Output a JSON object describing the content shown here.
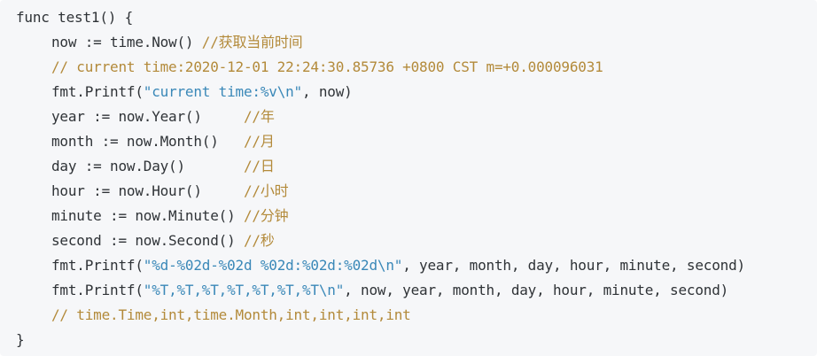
{
  "code": {
    "lines": [
      {
        "indent": 0,
        "tokens": [
          {
            "t": "plain",
            "text": "func test1() {"
          }
        ]
      },
      {
        "indent": 1,
        "tokens": [
          {
            "t": "plain",
            "text": "now := time.Now() "
          },
          {
            "t": "comment",
            "text": "//获取当前时间"
          }
        ]
      },
      {
        "indent": 1,
        "tokens": [
          {
            "t": "comment",
            "text": "// current time:2020-12-01 22:24:30.85736 +0800 CST m=+0.000096031"
          }
        ]
      },
      {
        "indent": 1,
        "tokens": [
          {
            "t": "plain",
            "text": "fmt.Printf("
          },
          {
            "t": "string",
            "text": "\"current time:%v\\n\""
          },
          {
            "t": "plain",
            "text": ", now)"
          }
        ]
      },
      {
        "indent": 1,
        "tokens": [
          {
            "t": "plain",
            "text": "year := now.Year()     "
          },
          {
            "t": "comment",
            "text": "//年"
          }
        ]
      },
      {
        "indent": 1,
        "tokens": [
          {
            "t": "plain",
            "text": "month := now.Month()   "
          },
          {
            "t": "comment",
            "text": "//月"
          }
        ]
      },
      {
        "indent": 1,
        "tokens": [
          {
            "t": "plain",
            "text": "day := now.Day()       "
          },
          {
            "t": "comment",
            "text": "//日"
          }
        ]
      },
      {
        "indent": 1,
        "tokens": [
          {
            "t": "plain",
            "text": "hour := now.Hour()     "
          },
          {
            "t": "comment",
            "text": "//小时"
          }
        ]
      },
      {
        "indent": 1,
        "tokens": [
          {
            "t": "plain",
            "text": "minute := now.Minute() "
          },
          {
            "t": "comment",
            "text": "//分钟"
          }
        ]
      },
      {
        "indent": 1,
        "tokens": [
          {
            "t": "plain",
            "text": "second := now.Second() "
          },
          {
            "t": "comment",
            "text": "//秒"
          }
        ]
      },
      {
        "indent": 1,
        "tokens": [
          {
            "t": "plain",
            "text": "fmt.Printf("
          },
          {
            "t": "string",
            "text": "\"%d-%02d-%02d %02d:%02d:%02d\\n\""
          },
          {
            "t": "plain",
            "text": ", year, month, day, hour, minute, second)"
          }
        ]
      },
      {
        "indent": 1,
        "tokens": [
          {
            "t": "plain",
            "text": "fmt.Printf("
          },
          {
            "t": "string",
            "text": "\"%T,%T,%T,%T,%T,%T,%T\\n\""
          },
          {
            "t": "plain",
            "text": ", now, year, month, day, hour, minute, second)"
          }
        ]
      },
      {
        "indent": 1,
        "tokens": [
          {
            "t": "comment",
            "text": "// time.Time,int,time.Month,int,int,int,int"
          }
        ]
      },
      {
        "indent": 0,
        "tokens": [
          {
            "t": "plain",
            "text": "}"
          }
        ]
      }
    ]
  },
  "colors": {
    "background": "#f6f7f9",
    "plain": "#2f3337",
    "string": "#3a88b8",
    "comment": "#b38a3a"
  }
}
